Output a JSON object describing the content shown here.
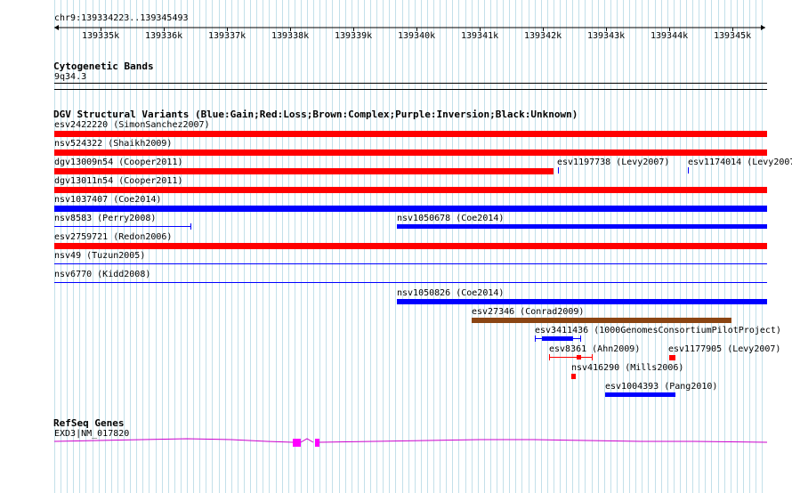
{
  "ruler": {
    "location": "chr9:139334223..139345493",
    "ticks": [
      "139335k",
      "139336k",
      "139337k",
      "139338k",
      "139339k",
      "139340k",
      "139341k",
      "139342k",
      "139343k",
      "139344k",
      "139345k"
    ]
  },
  "cytoband": {
    "title": "Cytogenetic Bands",
    "band": "9q34.3"
  },
  "dgv": {
    "title": "DGV Structural Variants (Blue:Gain;Red:Loss;Brown:Complex;Purple:Inversion;Black:Unknown)",
    "features": [
      {
        "label": "esv2422220 (SimonSanchez2007)",
        "color": "#ff0000"
      },
      {
        "label": "nsv524322 (Shaikh2009)",
        "color": "#ff0000"
      },
      {
        "label": "dgv13009n54 (Cooper2011)",
        "color": "#ff0000"
      },
      {
        "label": "esv1197738 (Levy2007)",
        "color": "#0000ff"
      },
      {
        "label": "esv1174014 (Levy2007)",
        "color": "#0000ff"
      },
      {
        "label": "dgv13011n54 (Cooper2011)",
        "color": "#ff0000"
      },
      {
        "label": "nsv1037407 (Coe2014)",
        "color": "#0000ff"
      },
      {
        "label": "nsv8583 (Perry2008)",
        "color": "#0000ff"
      },
      {
        "label": "nsv1050678 (Coe2014)",
        "color": "#0000ff"
      },
      {
        "label": "esv2759721 (Redon2006)",
        "color": "#ff0000"
      },
      {
        "label": "nsv49 (Tuzun2005)",
        "color": "#0000ff"
      },
      {
        "label": "nsv6770 (Kidd2008)",
        "color": "#0000ff"
      },
      {
        "label": "nsv1050826 (Coe2014)",
        "color": "#0000ff"
      },
      {
        "label": "esv27346 (Conrad2009)",
        "color": "#8b4513"
      },
      {
        "label": "esv3411436 (1000GenomesConsortiumPilotProject)",
        "color": "#0000ff"
      },
      {
        "label": "esv8361 (Ahn2009)",
        "color": "#ff0000"
      },
      {
        "label": "esv1177905 (Levy2007)",
        "color": "#ff0000"
      },
      {
        "label": "nsv416290 (Mills2006)",
        "color": "#ff0000"
      },
      {
        "label": "esv1004393 (Pang2010)",
        "color": "#0000ff"
      }
    ]
  },
  "refseq": {
    "title": "RefSeq Genes",
    "gene": "EXD3|NM_017820",
    "color": "#cc00cc"
  }
}
